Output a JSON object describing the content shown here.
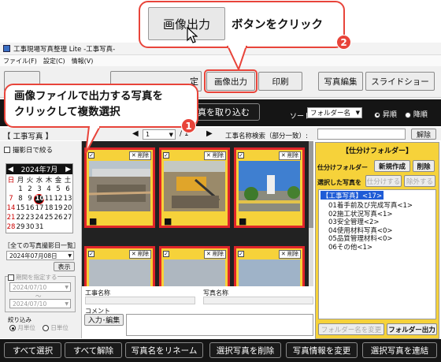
{
  "callout_top": {
    "button_label": "画像出力",
    "text": "ボタンをクリック",
    "number": "2"
  },
  "callout_left": {
    "line1": "画像ファイルで出力する写真を",
    "line2": "クリックして複数選択",
    "number": "1"
  },
  "window": {
    "title": "工事現場写真整理 Lite -工事写真-",
    "menu": [
      "ファイル(F)",
      "設定(C)",
      "情報(V)"
    ]
  },
  "toolbar": {
    "partial_label": "定",
    "image_output": "画像出力",
    "print": "印刷",
    "photo_edit": "写真編集",
    "slideshow": "スライドショー"
  },
  "dark_toolbar": {
    "import_label": "真を取り込む",
    "sort_label": "ソート",
    "sort_value": "フォルダー名",
    "asc": "昇順",
    "desc": "降順"
  },
  "nav": {
    "section": "【 工事写真 】",
    "page_value": "1",
    "page_total": "/ 1",
    "search_label": "工事名称検索（部分一致）:",
    "clear": "解除"
  },
  "left_panel": {
    "filter_by_date": "撮影日で絞る",
    "month": "2024年7月",
    "weekdays": [
      "日",
      "月",
      "火",
      "水",
      "木",
      "金",
      "土"
    ],
    "weeks": [
      [
        "",
        "1",
        "2",
        "3",
        "4",
        "5",
        "6"
      ],
      [
        "7",
        "8",
        "9",
        "10",
        "11",
        "12",
        "13"
      ],
      [
        "14",
        "15",
        "16",
        "17",
        "18",
        "19",
        "20"
      ],
      [
        "21",
        "22",
        "23",
        "24",
        "25",
        "26",
        "27"
      ],
      [
        "28",
        "29",
        "30",
        "31",
        "",
        "",
        ""
      ]
    ],
    "today": "10",
    "all_dates_label": "［全ての写真撮影日一覧］",
    "date_select": "2024年07月08日",
    "show": "表示",
    "period_label": "期間を指定する",
    "date_from": "2024/07/10",
    "date_to": "2024/07/10",
    "tilde": "～",
    "narrow_label": "絞り込み",
    "month_unit": "月単位",
    "day_unit": "日単位"
  },
  "thumbs": {
    "delete": "削除",
    "check": "✓"
  },
  "bottom_info": {
    "project_name": "工事名称",
    "photo_name": "写真名称",
    "comment": "コメント",
    "input_edit": "入力･編集"
  },
  "right_panel": {
    "title": "【仕分けフォルダー】",
    "folder_label": "仕分けフォルダー",
    "new": "新規作成",
    "delete": "削除",
    "selected_label": "選択した写真を",
    "sort_in": "仕分けする",
    "remove": "除外する",
    "tree": [
      "【工事写真】<17>",
      "01着手前及び完成写真<1>",
      "02施工状況写真<1>",
      "03安全管理<2>",
      "04使用材料写真<0>",
      "05品質管理材料<0>",
      "06その他<1>"
    ],
    "rename_folder": "フォルダー名を変更",
    "folder_output": "フォルダー出力"
  },
  "bottom_bar": [
    "すべて選択",
    "すべて解除",
    "写真名をリネーム",
    "選択写真を削除",
    "写真情報を変更",
    "選択写真を連結"
  ]
}
